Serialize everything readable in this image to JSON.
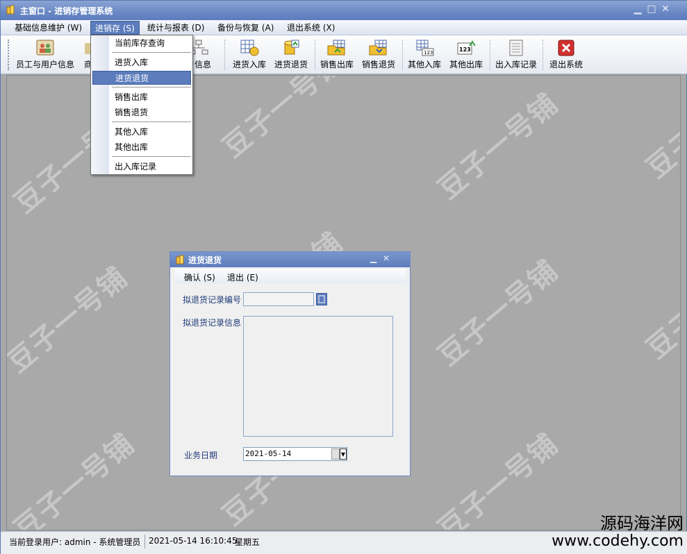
{
  "window": {
    "title": "主窗口 - 进销存管理系统",
    "controls": {
      "minimize": "▁",
      "maximize": "□",
      "close": "✕"
    }
  },
  "menubar": [
    "基础信息维护 (W)",
    "进销存 (S)",
    "统计与报表 (D)",
    "备份与恢复 (A)",
    "退出系统 (X)"
  ],
  "toolbar": {
    "items": [
      "员工与用户信息",
      "商",
      "户信息",
      "进货入库",
      "进货退货",
      "销售出库",
      "销售退货",
      "其他入库",
      "其他出库",
      "出入库记录",
      "退出系统"
    ]
  },
  "dropdown": {
    "items": [
      "当前库存查询",
      "进货入库",
      "进货退货",
      "销售出库",
      "销售退货",
      "其他入库",
      "其他出库",
      "出入库记录"
    ],
    "highlighted": "进货退货"
  },
  "dialog": {
    "title": "进货退货",
    "menu": [
      "确认 (S)",
      "退出 (E)"
    ],
    "record_no_label": "拟退货记录编号",
    "record_no_value": "",
    "record_info_label": "拟退货记录信息",
    "record_info_value": "",
    "date_label": "业务日期",
    "date_value": "2021-05-14"
  },
  "statusbar": {
    "user": "当前登录用户: admin - 系统管理员",
    "datetime": "2021-05-14 16:10:45",
    "weekday": "星期五"
  },
  "watermark": {
    "text": "豆子一号铺",
    "site_cn": "源码海洋网",
    "site_url": "www.codehy.com"
  },
  "colors": {
    "titlebar": "#6a88c4",
    "highlight": "#5c7cbc",
    "mdi_background": "#a9a9a9",
    "label_text": "#1e3a78"
  }
}
